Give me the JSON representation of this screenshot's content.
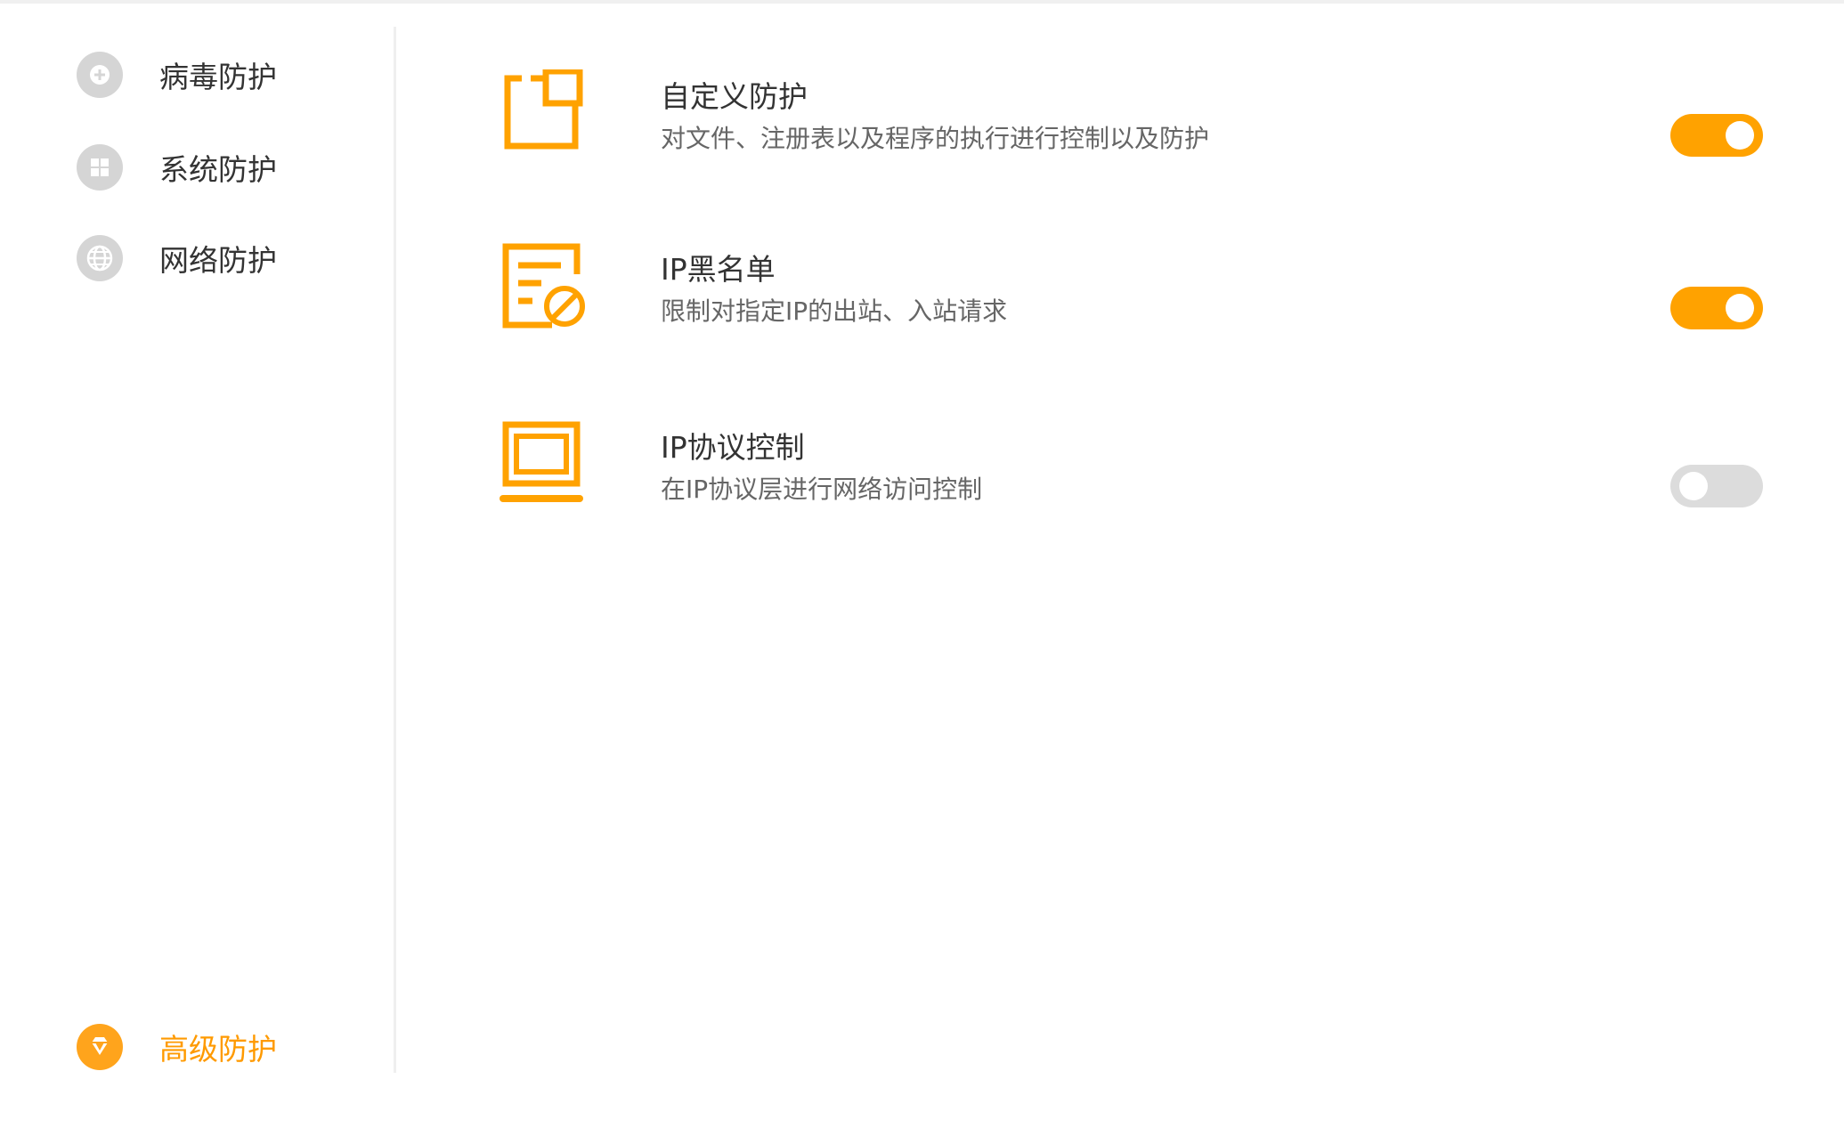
{
  "sidebar": {
    "items": [
      {
        "label": "病毒防护",
        "icon": "plus-circle-icon",
        "active": false
      },
      {
        "label": "系统防护",
        "icon": "windows-icon",
        "active": false
      },
      {
        "label": "网络防护",
        "icon": "globe-icon",
        "active": false
      },
      {
        "label": "高级防护",
        "icon": "diamond-icon",
        "active": true
      }
    ]
  },
  "features": [
    {
      "title": "自定义防护",
      "description": "对文件、注册表以及程序的执行进行控制以及防护",
      "icon": "custom-protection-icon",
      "enabled": true
    },
    {
      "title": "IP黑名单",
      "description": "限制对指定IP的出站、入站请求",
      "icon": "ip-blacklist-icon",
      "enabled": true
    },
    {
      "title": "IP协议控制",
      "description": "在IP协议层进行网络访问控制",
      "icon": "ip-protocol-icon",
      "enabled": false
    }
  ],
  "colors": {
    "accent": "#ffa200",
    "toggle_off": "#dcdcdc",
    "nav_icon_inactive": "#d5d5d5",
    "text_primary": "#333333",
    "text_secondary": "#666666"
  }
}
